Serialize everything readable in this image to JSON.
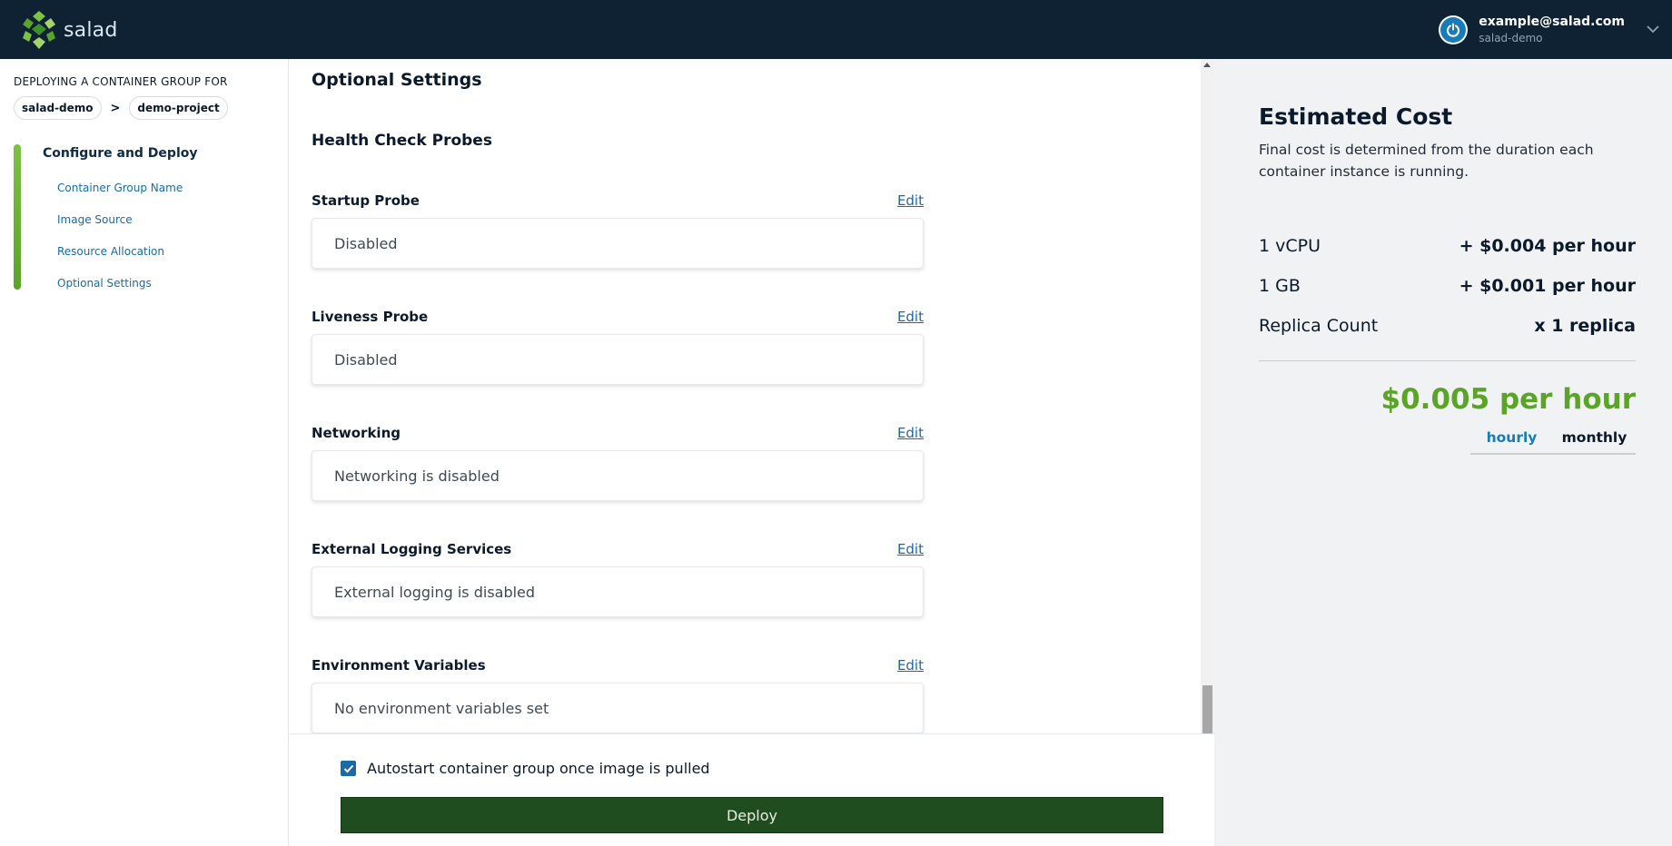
{
  "header": {
    "brand": "salad",
    "account_email": "example@salad.com",
    "account_org": "salad-demo"
  },
  "sidebar": {
    "deploying_for": "DEPLOYING A CONTAINER GROUP FOR",
    "breadcrumb": [
      "salad-demo",
      ">",
      "demo-project"
    ],
    "step_title": "Configure and Deploy",
    "steps": [
      "Container Group Name",
      "Image Source",
      "Resource Allocation",
      "Optional Settings"
    ]
  },
  "main": {
    "section_title": "Optional Settings",
    "sub_title": "Health Check Probes",
    "edit_label": "Edit",
    "settings": [
      {
        "label": "Startup Probe",
        "value": "Disabled"
      },
      {
        "label": "Liveness Probe",
        "value": "Disabled"
      },
      {
        "label": "Networking",
        "value": "Networking is disabled"
      },
      {
        "label": "External Logging Services",
        "value": "External logging is disabled"
      },
      {
        "label": "Environment Variables",
        "value": "No environment variables set"
      }
    ]
  },
  "footer": {
    "autostart_label": "Autostart container group once image is pulled",
    "autostart_checked": true,
    "deploy_label": "Deploy"
  },
  "cost": {
    "title": "Estimated Cost",
    "description": "Final cost is determined from the duration each container instance is running.",
    "rows": [
      {
        "label": "1 vCPU",
        "value": "+ $0.004 per hour"
      },
      {
        "label": "1 GB",
        "value": "+ $0.001 per hour"
      },
      {
        "label": "Replica Count",
        "value": "x 1 replica"
      }
    ],
    "total": "$0.005 per hour",
    "periods": [
      "hourly",
      "monthly"
    ],
    "active_period": "hourly",
    "total_color": "#5aa427"
  }
}
